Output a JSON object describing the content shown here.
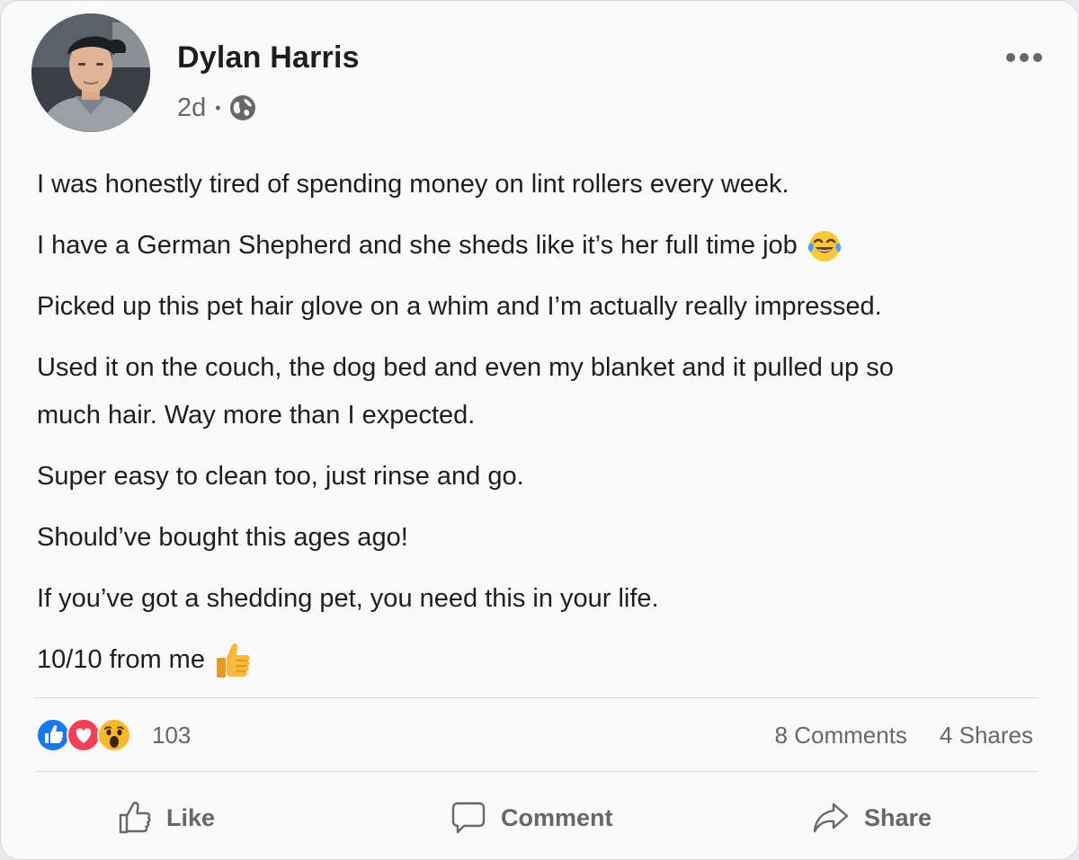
{
  "post": {
    "author": "Dylan Harris",
    "time": "2d",
    "separator": "•",
    "privacy_icon": "globe-icon",
    "more_icon": "ellipsis-icon",
    "paragraphs": [
      {
        "text": "I was honestly tired of spending money on lint rollers every week."
      },
      {
        "text": "I have a German Shepherd and she sheds like it’s her full time job",
        "emoji": "tears-of-joy-emoji"
      },
      {
        "text": "Picked up this pet hair glove on a whim and I’m actually really impressed."
      },
      {
        "text": "Used it on the couch, the dog bed and even my blanket and it pulled up so much hair. Way more than I expected."
      },
      {
        "text": "Super easy to clean too, just rinse and go."
      },
      {
        "text": "Should’ve bought this ages ago!"
      },
      {
        "text": "If you’ve got a shedding pet, you need this in your life."
      },
      {
        "text": "10/10 from me",
        "emoji": "thumbs-up-emoji"
      }
    ]
  },
  "stats": {
    "reaction_icons": [
      "like-reaction-icon",
      "love-reaction-icon",
      "wow-reaction-icon"
    ],
    "reaction_count": "103",
    "comments": "8 Comments",
    "shares": "4 Shares"
  },
  "actions": {
    "like": "Like",
    "comment": "Comment",
    "share": "Share"
  },
  "colors": {
    "like_blue": "#1877f2",
    "love_red": "#f33e58",
    "wow_yellow": "#f7b928",
    "muted_text": "#65676b"
  }
}
